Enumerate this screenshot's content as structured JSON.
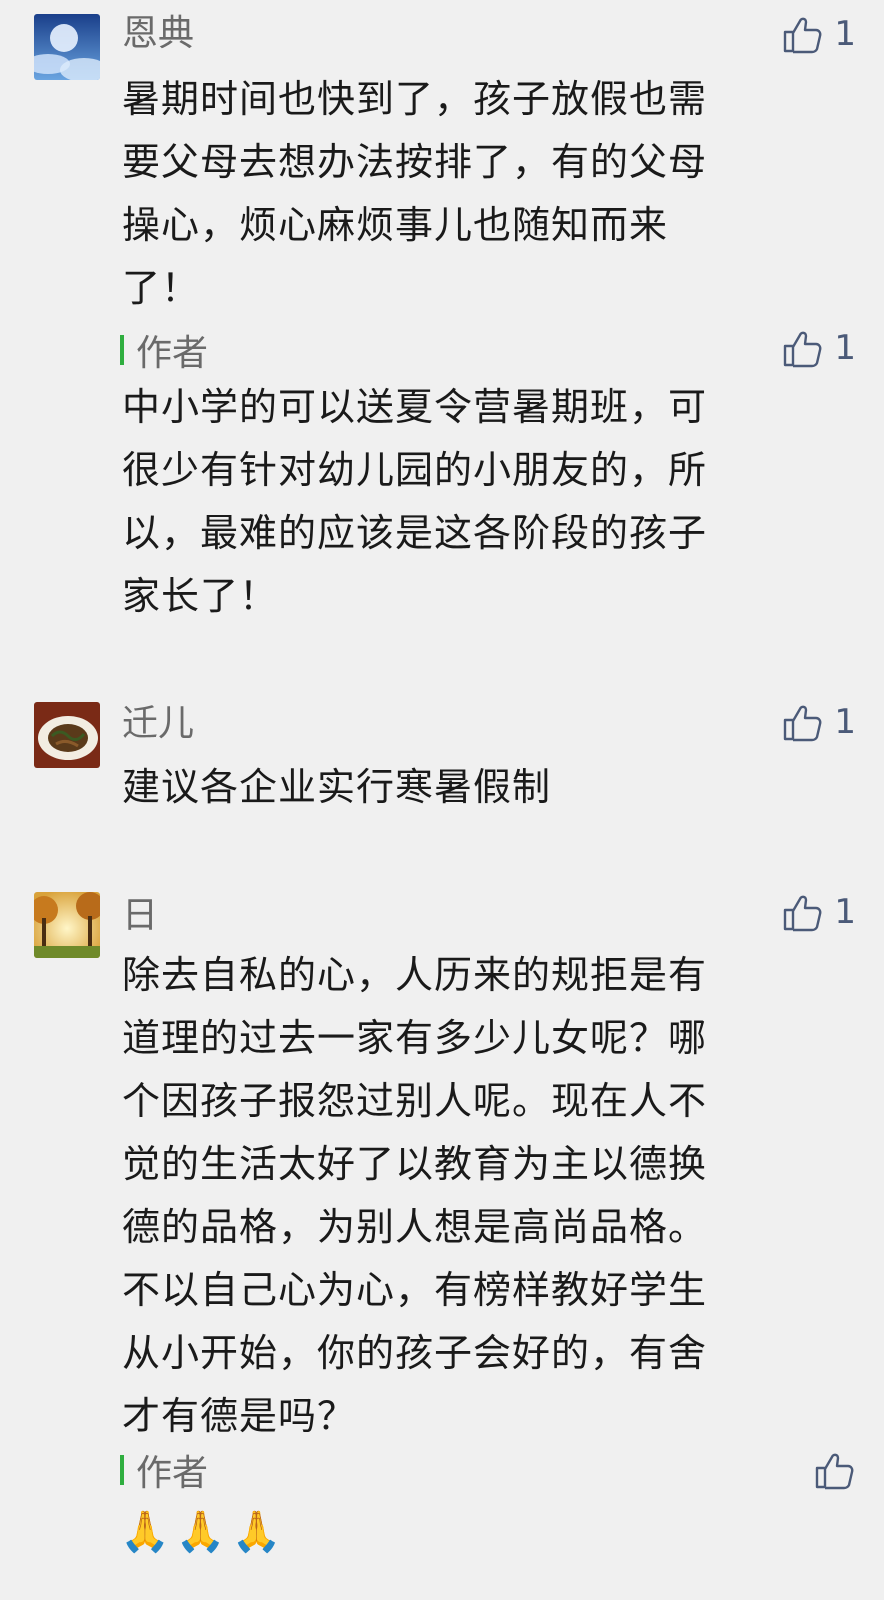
{
  "comments": [
    {
      "name": "恩典",
      "likes": "1",
      "text": "暑期时间也快到了，孩子放假也需\n要父母去想办法按排了，有的父母\n操心，烦心麻烦事儿也随知而来\n了！",
      "reply": {
        "label": "作者",
        "likes": "1",
        "text": "中小学的可以送夏令营暑期班，可\n很少有针对幼儿园的小朋友的，所\n以，最难的应该是这各阶段的孩子\n家长了！"
      }
    },
    {
      "name": "迁儿",
      "likes": "1",
      "text": "建议各企业实行寒暑假制"
    },
    {
      "name": "日",
      "likes": "1",
      "text": "除去自私的心，人历来的规拒是有\n道理的过去一家有多少儿女呢？哪\n个因孩子报怨过别人呢。现在人不\n觉的生活太好了以教育为主以德换\n德的品格，为别人想是高尚品格。\n不以自己心为心，有榜样教好学生\n从小开始，你的孩子会好的，有舍\n才有德是吗？",
      "reply": {
        "label": "作者",
        "emojis": "🙏🙏🙏"
      }
    }
  ],
  "icons": {
    "like": "thumbs-up-icon",
    "avatar_1": "moon-sky-avatar",
    "avatar_2": "food-plate-avatar",
    "avatar_3": "autumn-trees-avatar"
  },
  "colors": {
    "background": "#f0f0f0",
    "like": "#4b5a78",
    "author_bar": "#2fae3f",
    "name": "#6a6a6a"
  }
}
